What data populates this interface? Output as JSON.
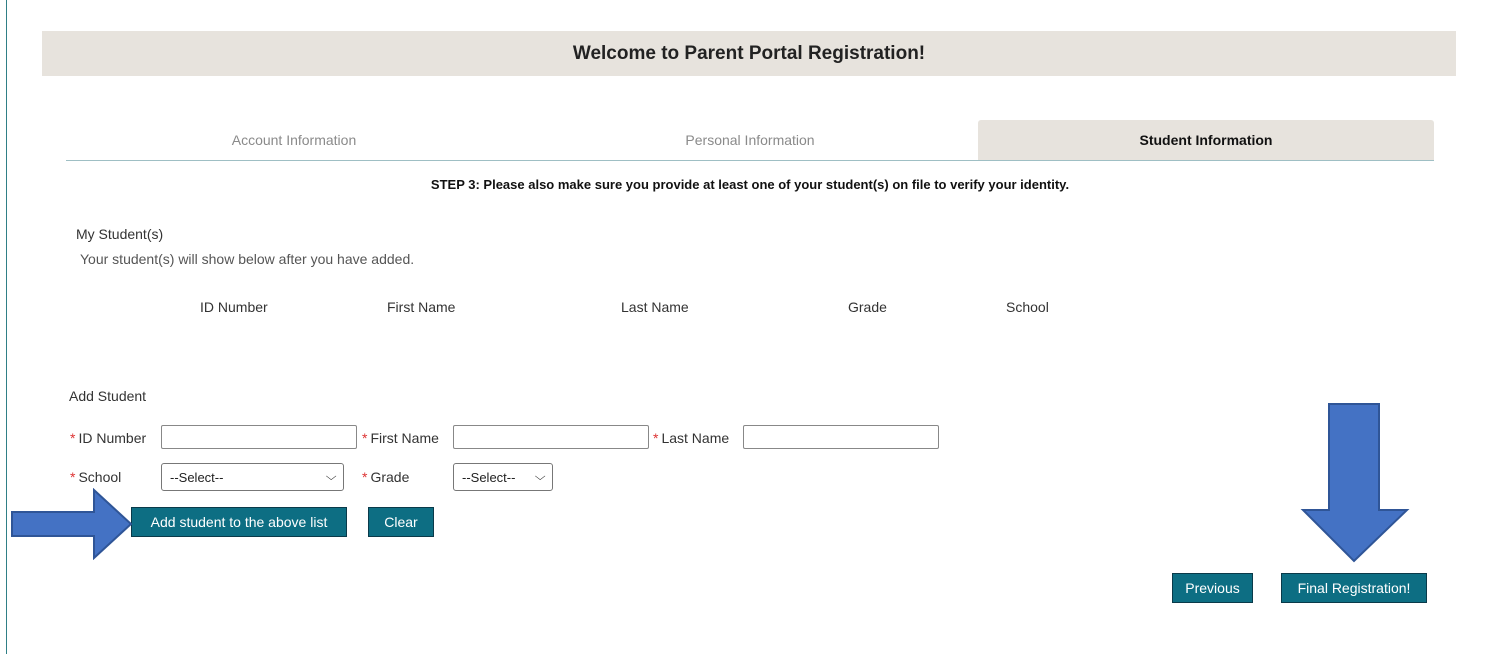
{
  "header": {
    "title": "Welcome to Parent Portal Registration!"
  },
  "tabs": [
    {
      "label": "Account Information",
      "active": false
    },
    {
      "label": "Personal Information",
      "active": false
    },
    {
      "label": "Student Information",
      "active": true
    }
  ],
  "step_text": "STEP 3: Please also make sure you provide at least one of your student(s) on file to verify your identity.",
  "students": {
    "title": "My Student(s)",
    "hint": "Your student(s) will show below after you have added.",
    "columns": [
      "ID Number",
      "First Name",
      "Last Name",
      "Grade",
      "School"
    ]
  },
  "add_student": {
    "title": "Add Student",
    "required_mark": "*",
    "id_label": "ID Number",
    "first_name_label": "First Name",
    "last_name_label": "Last Name",
    "school_label": "School",
    "grade_label": "Grade",
    "school_selected": "--Select--",
    "grade_selected": "--Select--",
    "add_button": "Add student to the above list",
    "clear_button": "Clear"
  },
  "nav": {
    "previous_button": "Previous",
    "final_button": "Final Registration!"
  },
  "colors": {
    "accent": "#0d6e83",
    "header_bg": "#e7e3dd",
    "arrow": "#4472c4",
    "required": "#dd3333"
  }
}
